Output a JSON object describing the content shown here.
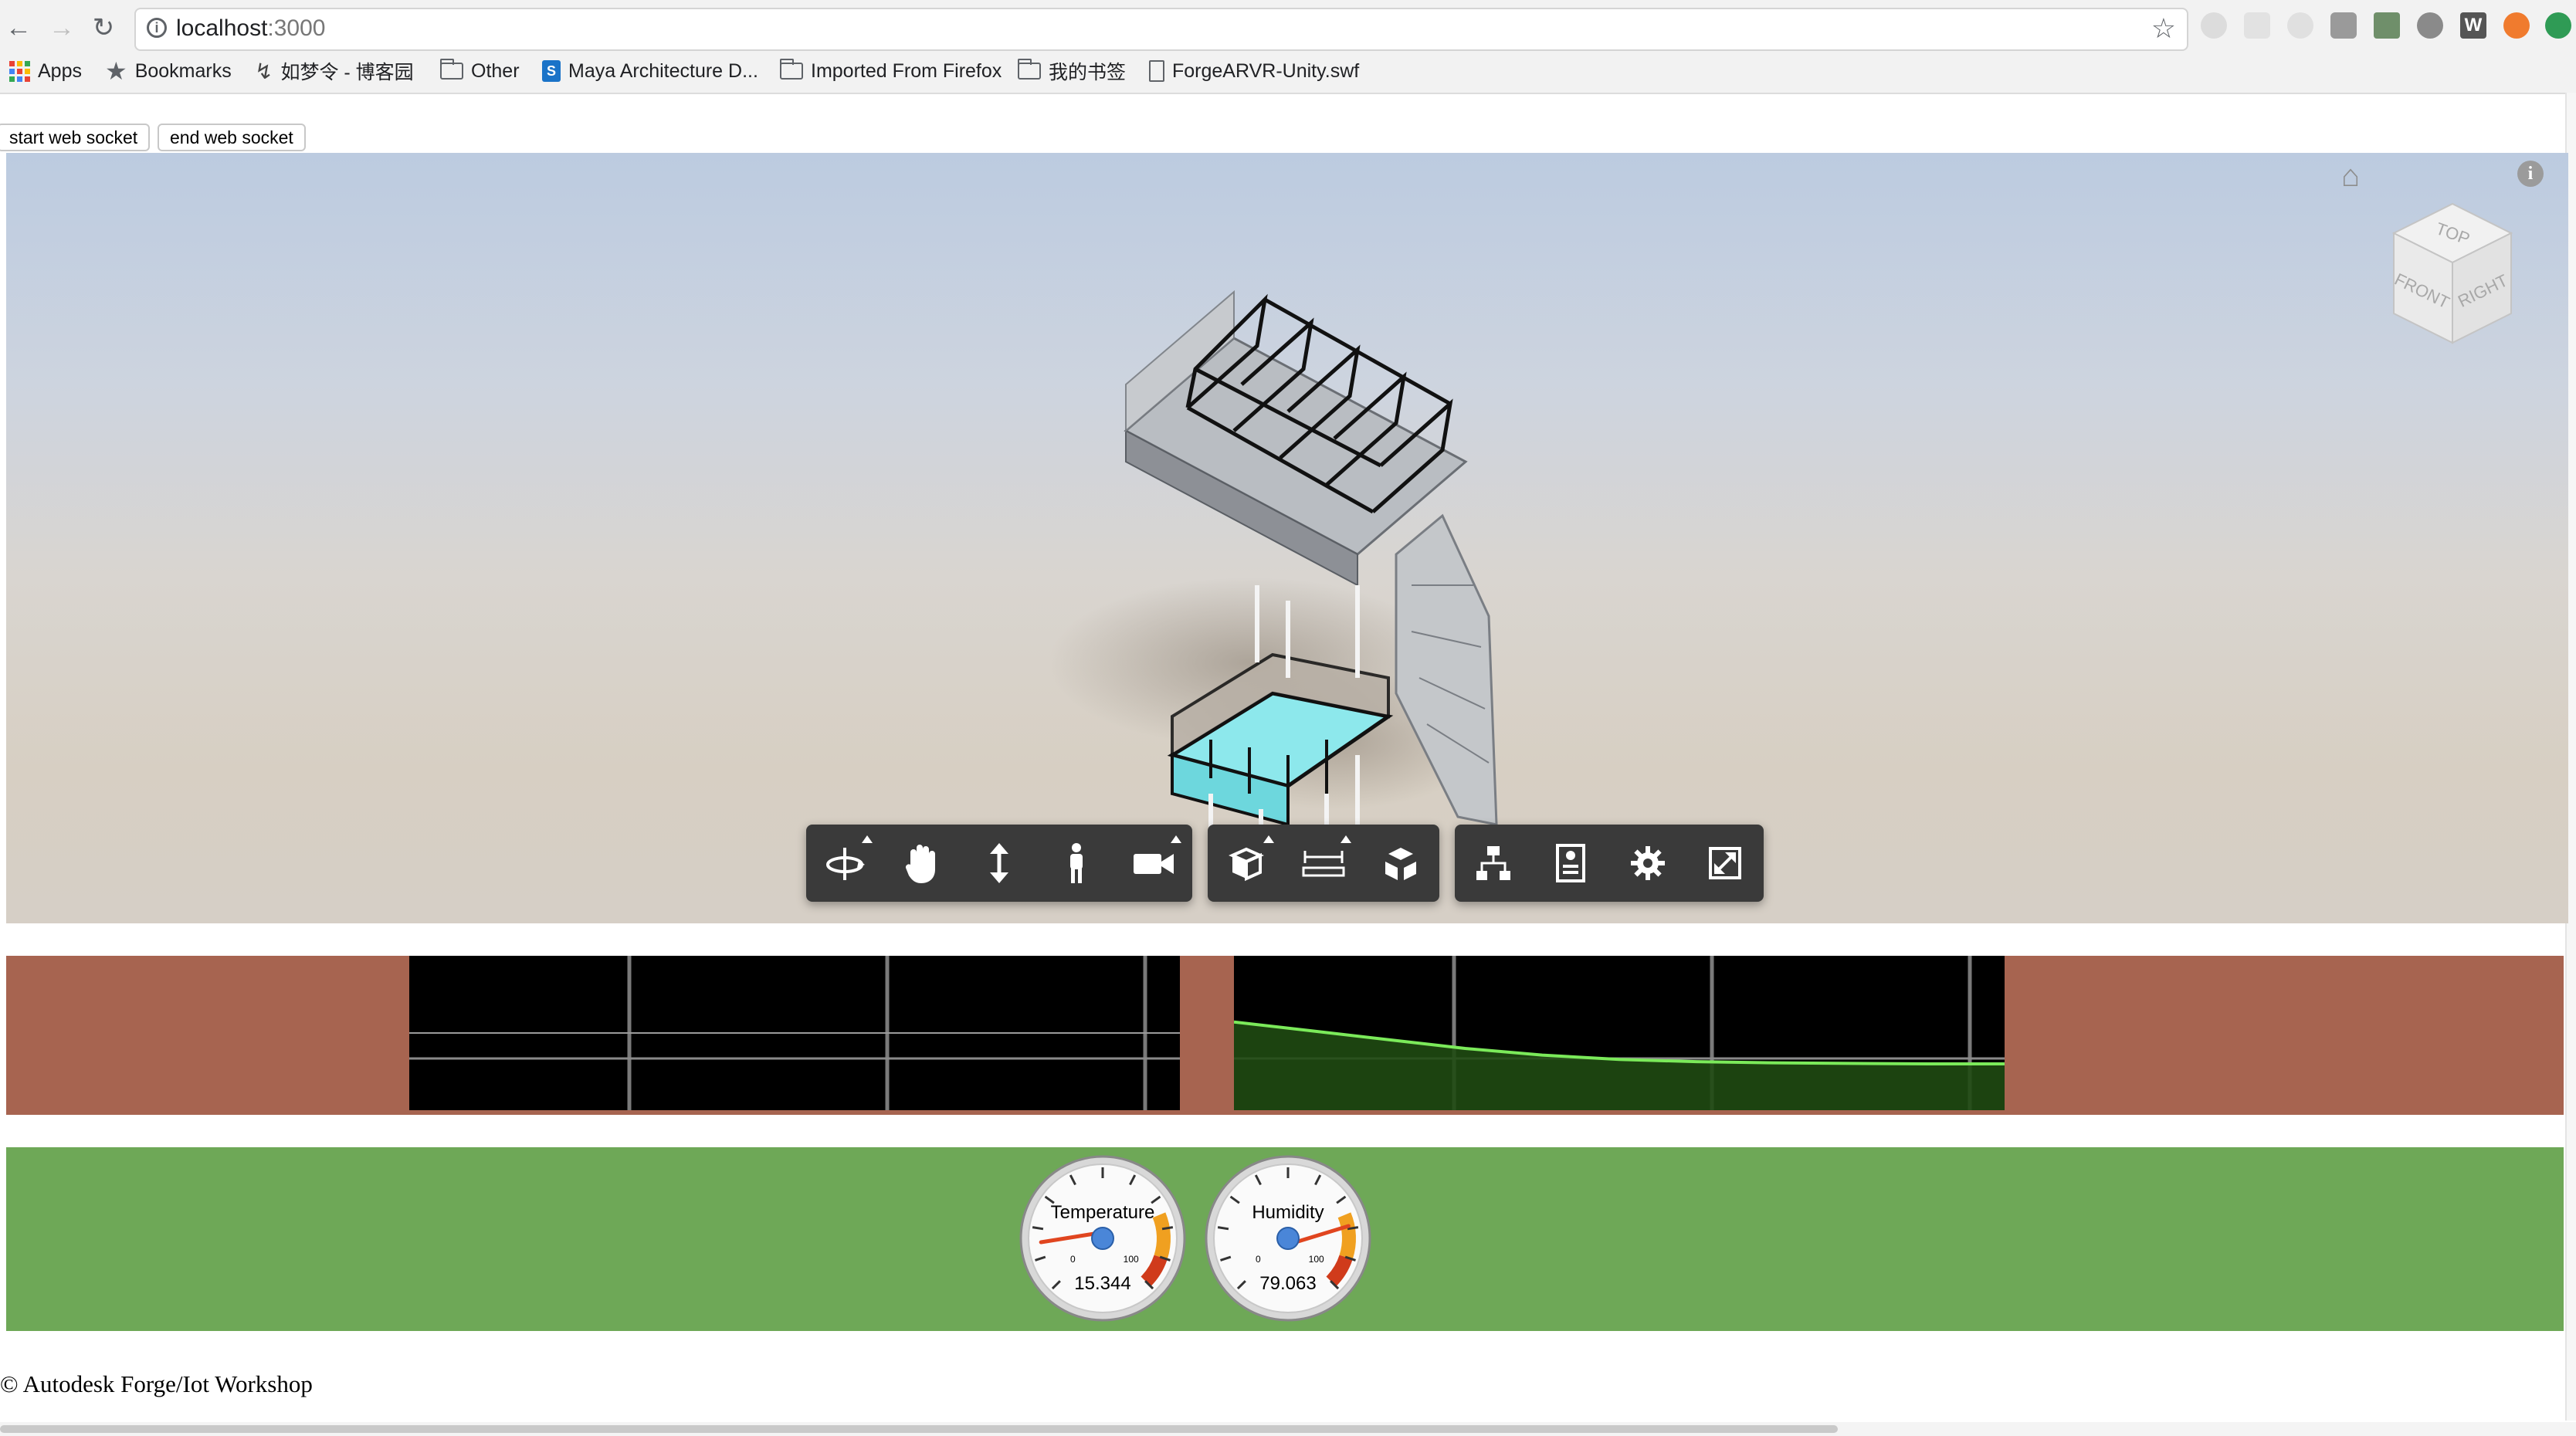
{
  "browser": {
    "url_host": "localhost",
    "url_port": ":3000",
    "bookmarks": [
      {
        "label": "Apps"
      },
      {
        "label": "Bookmarks"
      },
      {
        "label": "如梦令 - 博客园"
      },
      {
        "label": "Other"
      },
      {
        "label": "Maya Architecture D..."
      },
      {
        "label": "Imported From Firefox"
      },
      {
        "label": "我的书签"
      },
      {
        "label": "ForgeARVR-Unity.swf"
      }
    ]
  },
  "page": {
    "start_button": "start web socket",
    "end_button": "end web socket",
    "footer": "© Autodesk Forge/Iot Workshop"
  },
  "viewer": {
    "viewcube": {
      "top": "TOP",
      "front": "FRONT",
      "right": "RIGHT"
    },
    "toolbar": {
      "groups": [
        [
          "orbit-icon",
          "pan-icon",
          "zoom-icon",
          "first-person-icon",
          "camera-icon"
        ],
        [
          "section-icon",
          "measure-icon",
          "explode-icon"
        ],
        [
          "model-browser-icon",
          "properties-icon",
          "settings-icon",
          "fullscreen-icon"
        ]
      ]
    }
  },
  "gauges": [
    {
      "label": "Temperature",
      "value": "15.344",
      "min_label": "0",
      "max_label": "100",
      "level": 0.15344
    },
    {
      "label": "Humidity",
      "value": "79.063",
      "min_label": "0",
      "max_label": "100",
      "level": 0.79063
    }
  ],
  "chart_data": [
    {
      "type": "line",
      "series": [
        {
          "values": [
            0,
            0,
            0,
            0,
            0,
            0,
            0,
            0,
            0,
            0
          ]
        }
      ],
      "ylim": [
        -1,
        1
      ]
    },
    {
      "type": "area",
      "series": [
        {
          "values": [
            30,
            26,
            22,
            18,
            15,
            13,
            12,
            11.5,
            11.2,
            11,
            11
          ]
        }
      ],
      "ylim": [
        -10,
        60
      ],
      "color": "#7bea5a"
    }
  ]
}
